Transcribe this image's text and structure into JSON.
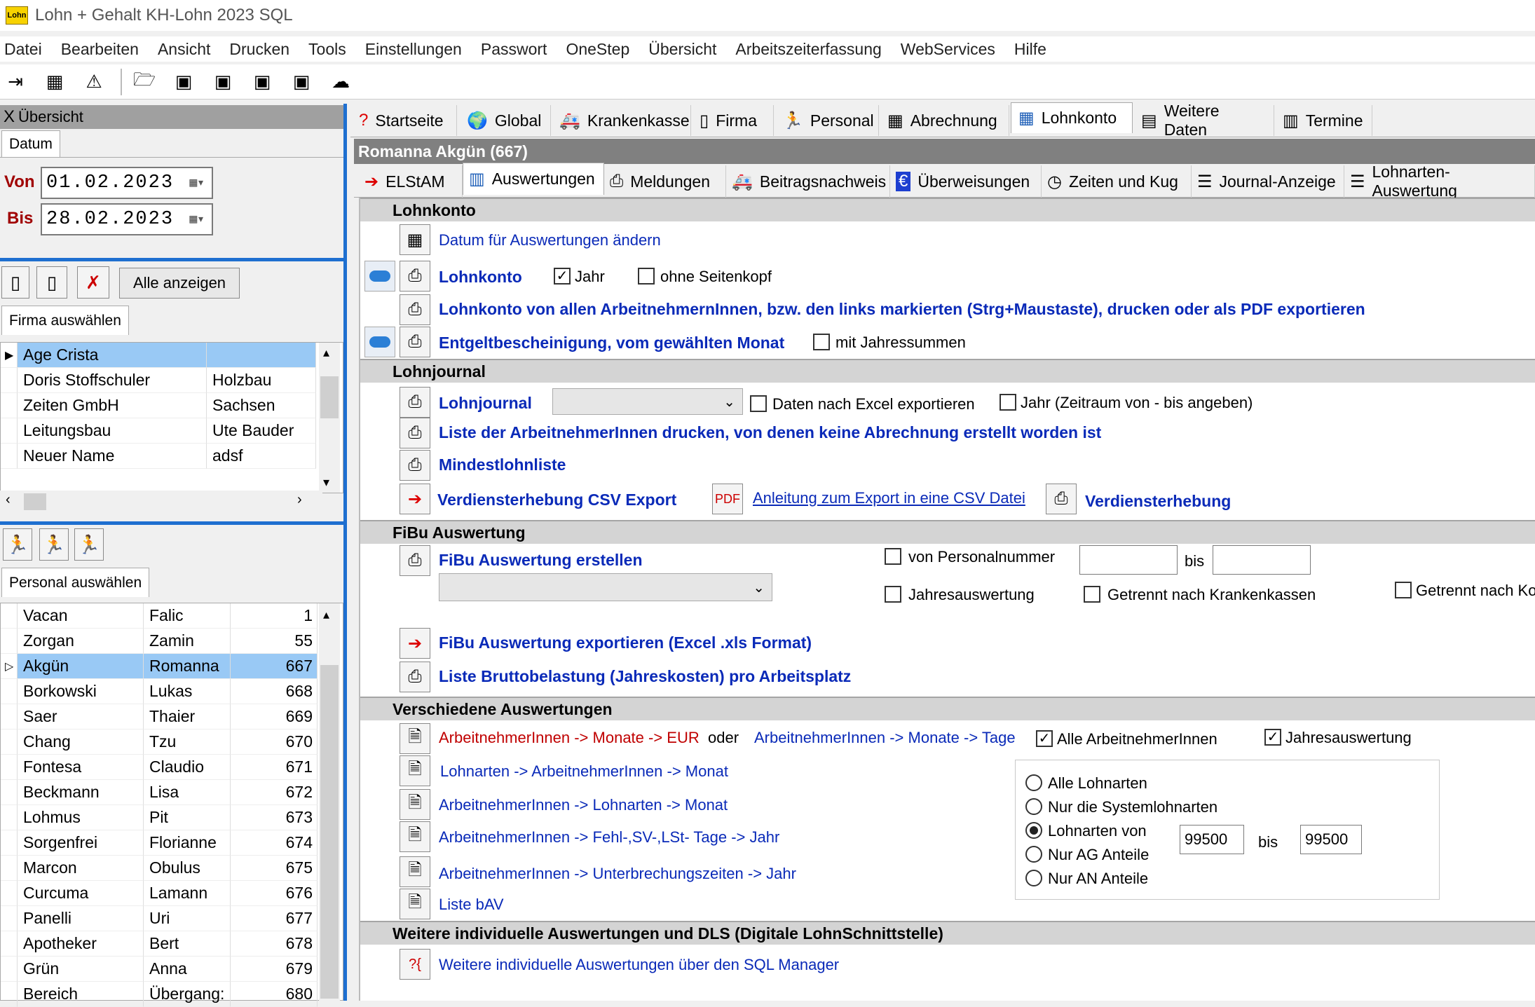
{
  "window": {
    "title": "Lohn + Gehalt KH-Lohn 2023 SQL",
    "logo_text": "Lohn"
  },
  "menu": [
    "Datei",
    "Bearbeiten",
    "Ansicht",
    "Drucken",
    "Tools",
    "Einstellungen",
    "Passwort",
    "OneStep",
    "Übersicht",
    "Arbeitszeiterfassung",
    "WebServices",
    "Hilfe"
  ],
  "left": {
    "panel_title": "Übersicht",
    "close_glyph": "X",
    "date_tab": "Datum",
    "von_label": "Von",
    "von_value": "01.02.2023",
    "bis_label": "Bis",
    "bis_value": "28.02.2023",
    "show_all": "Alle anzeigen",
    "firma_tab": "Firma auswählen",
    "firms": [
      {
        "name": "Age Crista",
        "info": "",
        "selected": true
      },
      {
        "name": "Doris Stoffschuler",
        "info": "Holzbau",
        "selected": false
      },
      {
        "name": "Zeiten GmbH",
        "info": "Sachsen",
        "selected": false
      },
      {
        "name": "Leitungsbau",
        "info": "Ute Bauder",
        "selected": false
      },
      {
        "name": "Neuer Name",
        "info": "adsf",
        "selected": false
      }
    ],
    "personal_tab": "Personal auswählen",
    "staff": [
      {
        "last": "Vacan",
        "first": "Falic",
        "nr": "1",
        "selected": false
      },
      {
        "last": "Zorgan",
        "first": "Zamin",
        "nr": "55",
        "selected": false
      },
      {
        "last": "Akgün",
        "first": "Romanna",
        "nr": "667",
        "selected": true
      },
      {
        "last": "Borkowski",
        "first": "Lukas",
        "nr": "668",
        "selected": false
      },
      {
        "last": "Saer",
        "first": "Thaier",
        "nr": "669",
        "selected": false
      },
      {
        "last": "Chang",
        "first": "Tzu",
        "nr": "670",
        "selected": false
      },
      {
        "last": "Fontesa",
        "first": "Claudio",
        "nr": "671",
        "selected": false
      },
      {
        "last": "Beckmann",
        "first": "Lisa",
        "nr": "672",
        "selected": false
      },
      {
        "last": "Lohmus",
        "first": "Pit",
        "nr": "673",
        "selected": false
      },
      {
        "last": "Sorgenfrei",
        "first": "Florianne",
        "nr": "674",
        "selected": false
      },
      {
        "last": "Marcon",
        "first": "Obulus",
        "nr": "675",
        "selected": false
      },
      {
        "last": "Curcuma",
        "first": "Lamann",
        "nr": "676",
        "selected": false
      },
      {
        "last": "Panelli",
        "first": "Uri",
        "nr": "677",
        "selected": false
      },
      {
        "last": "Apotheker",
        "first": "Bert",
        "nr": "678",
        "selected": false
      },
      {
        "last": "Grün",
        "first": "Anna",
        "nr": "679",
        "selected": false
      },
      {
        "last": "Bereich",
        "first": "Übergang:",
        "nr": "680",
        "selected": false
      }
    ]
  },
  "main_tabs": [
    {
      "label": "Startseite",
      "icon": "?"
    },
    {
      "label": "Global",
      "icon": "🌍"
    },
    {
      "label": "Krankenkasse",
      "icon": "🚑"
    },
    {
      "label": "Firma",
      "icon": "▯"
    },
    {
      "label": "Personal",
      "icon": "🏃"
    },
    {
      "label": "Abrechnung",
      "icon": "▦"
    },
    {
      "label": "Lohnkonto",
      "icon": "▦"
    },
    {
      "label": "Weitere Daten",
      "icon": "▤"
    },
    {
      "label": "Termine",
      "icon": "▥"
    }
  ],
  "employee_header": "Romanna Akgün (667)",
  "sub_tabs": [
    {
      "label": "ELStAM",
      "icon": "➔"
    },
    {
      "label": "Auswertungen",
      "icon": "▥"
    },
    {
      "label": "Meldungen",
      "icon": "⎙"
    },
    {
      "label": "Beitragsnachweis",
      "icon": "🚑"
    },
    {
      "label": "Überweisungen",
      "icon": "€"
    },
    {
      "label": "Zeiten und Kug",
      "icon": "◷"
    },
    {
      "label": "Journal-Anzeige",
      "icon": "☰"
    },
    {
      "label": "Lohnarten-Auswertung",
      "icon": "☰"
    }
  ],
  "sections": {
    "lohnkonto": {
      "title": "Lohnkonto",
      "datum_link": "Datum für Auswertungen ändern",
      "lohnkonto_label": "Lohnkonto",
      "jahr_label": "Jahr",
      "jahr_checked": true,
      "seitenkopf_label": "ohne Seitenkopf",
      "seitenkopf_checked": false,
      "alle_label": "Lohnkonto von allen ArbeitnehmernInnen, bzw. den links markierten (Strg+Maustaste), drucken oder als PDF exportieren",
      "entgelt_label": "Entgeltbescheinigung, vom gewählten Monat",
      "jahressummen_label": "mit Jahressummen",
      "jahressummen_checked": false
    },
    "lohnjournal": {
      "title": "Lohnjournal",
      "journal_label": "Lohnjournal",
      "excel_label": "Daten nach Excel exportieren",
      "jahr_zeitraum_label": "Jahr (Zeitraum von - bis angeben)",
      "liste_label": "Liste der ArbeitnehmerInnen drucken, von denen keine Abrechnung erstellt worden ist",
      "mindest_label": "Mindestlohnliste",
      "csv_label": "Verdiensterhebung CSV Export",
      "anleitung_label": "Anleitung zum Export in eine CSV Datei",
      "verdienst_label": "Verdiensterhebung"
    },
    "fibu": {
      "title": "FiBu Auswertung",
      "erstellen_label": "FiBu Auswertung erstellen",
      "von_pers_label": "von Personalnummer",
      "bis_label": "bis",
      "jahres_label": "Jahresauswertung",
      "getrennt_kk_label": "Getrennt nach Krankenkassen",
      "getrennt_ko_label": "Getrennt nach Ko",
      "export_label": "FiBu Auswertung exportieren (Excel .xls Format)",
      "brutto_label": "Liste Bruttobelastung (Jahreskosten) pro Arbeitsplatz"
    },
    "verschiedene": {
      "title": "Verschiedene Auswertungen",
      "an_monate_eur": "ArbeitnehmerInnen -> Monate -> EUR",
      "oder": "oder",
      "an_monate_tage": "ArbeitnehmerInnen -> Monate -> Tage",
      "alle_an_label": "Alle ArbeitnehmerInnen",
      "alle_an_checked": true,
      "jahresausw_label": "Jahresauswertung",
      "jahresausw_checked": true,
      "lohnarten_an_monat": "Lohnarten -> ArbeitnehmerInnen -> Monat",
      "an_lohnarten_monat": "ArbeitnehmerInnen -> Lohnarten -> Monat",
      "an_fehl": "ArbeitnehmerInnen -> Fehl-,SV-,LSt- Tage -> Jahr",
      "an_unterbrechung": "ArbeitnehmerInnen -> Unterbrechungszeiten -> Jahr",
      "liste_bav": "Liste bAV",
      "radio": [
        {
          "label": "Alle Lohnarten",
          "checked": false
        },
        {
          "label": "Nur die Systemlohnarten",
          "checked": false
        },
        {
          "label": "Lohnarten von",
          "checked": true
        },
        {
          "label": "Nur AG Anteile",
          "checked": false
        },
        {
          "label": "Nur AN Anteile",
          "checked": false
        }
      ],
      "lohnart_von": "99500",
      "lohnart_bis_label": "bis",
      "lohnart_bis": "99500"
    },
    "weitere": {
      "title": "Weitere individuelle Auswertungen und DLS  (Digitale LohnSchnittstelle)",
      "sql_label": "Weitere individuelle Auswertungen über den SQL Manager"
    }
  }
}
